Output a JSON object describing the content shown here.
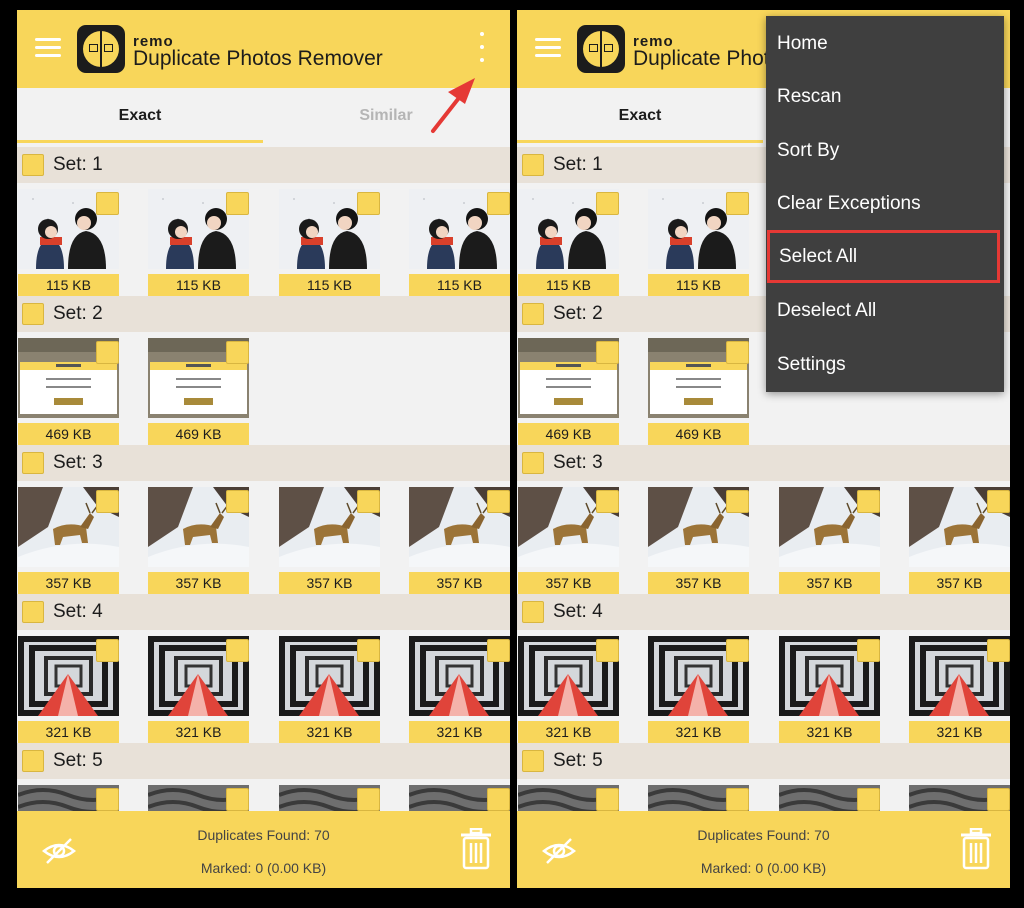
{
  "app": {
    "brand": "remo",
    "title": "Duplicate Photos Remover"
  },
  "tabs": [
    {
      "label": "Exact",
      "active": true
    },
    {
      "label": "Similar",
      "active": false
    }
  ],
  "sets": [
    {
      "label": "Set: 1",
      "photo": "couple",
      "thumbs": [
        "115 KB",
        "115 KB",
        "115 KB",
        "115 KB"
      ]
    },
    {
      "label": "Set: 2",
      "photo": "dialog",
      "thumbs": [
        "469 KB",
        "469 KB"
      ]
    },
    {
      "label": "Set: 3",
      "photo": "deer",
      "thumbs": [
        "357 KB",
        "357 KB",
        "357 KB",
        "357 KB"
      ]
    },
    {
      "label": "Set: 4",
      "photo": "corridor",
      "thumbs": [
        "321 KB",
        "321 KB",
        "321 KB",
        "321 KB"
      ]
    },
    {
      "label": "Set: 5",
      "photo": "texture",
      "thumbs": [
        "",
        "",
        "",
        ""
      ]
    }
  ],
  "footer": {
    "duplicates": "Duplicates Found: 70",
    "marked": "Marked: 0 (0.00 KB)"
  },
  "menu": {
    "items": [
      "Home",
      "Rescan",
      "Sort By",
      "Clear Exceptions",
      "Select All",
      "Deselect All",
      "Settings"
    ],
    "highlighted": "Select All"
  },
  "icons": {
    "menu": "hamburger-icon",
    "more": "more-vertical-icon",
    "hide": "eye-off-icon",
    "delete": "trash-icon",
    "annotation": "red-arrow-icon"
  },
  "colors": {
    "accent": "#f8d65a",
    "set_header": "#e8e1d8",
    "menu_bg": "#3f3f3f",
    "highlight": "#e53935"
  }
}
